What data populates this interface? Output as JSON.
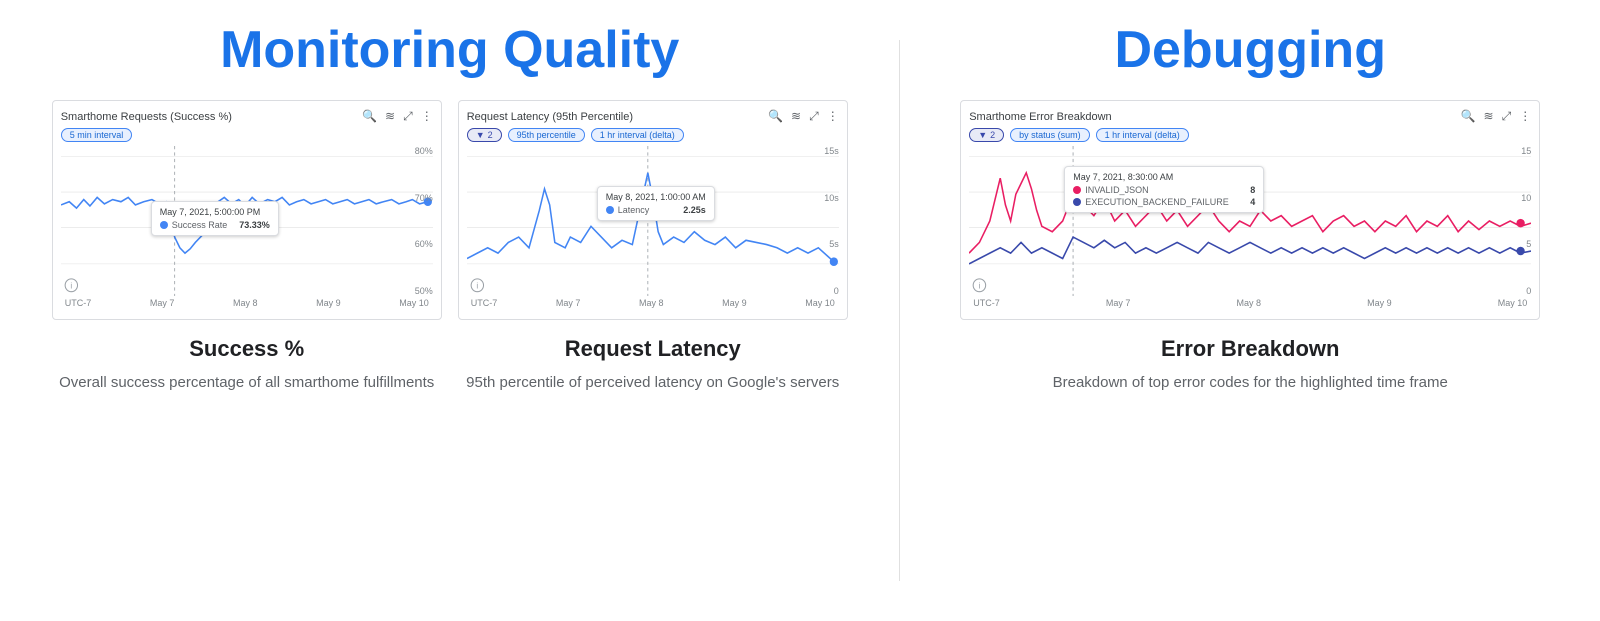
{
  "monitoring": {
    "title": "Monitoring Quality",
    "charts": [
      {
        "id": "success-rate",
        "title": "Smarthome Requests (Success %)",
        "filters": [
          "5 min interval"
        ],
        "filter_count": null,
        "y_labels": [
          "80%",
          "70%",
          "60%",
          "50%"
        ],
        "x_labels": [
          "UTC-7",
          "May 7",
          "May 8",
          "May 9",
          "May 10"
        ],
        "tooltip": {
          "date": "May 7, 2021, 5:00:00 PM",
          "metric": "Success Rate",
          "value": "73.33%",
          "color": "#4285f4"
        },
        "color": "#4285f4"
      },
      {
        "id": "request-latency",
        "title": "Request Latency (95th Percentile)",
        "filters": [
          "95th percentile",
          "1 hr interval (delta)"
        ],
        "filter_count": "2",
        "y_labels": [
          "15s",
          "10s",
          "5s",
          "0"
        ],
        "x_labels": [
          "UTC-7",
          "May 7",
          "May 8",
          "May 9",
          "May 10"
        ],
        "tooltip": {
          "date": "May 8, 2021, 1:00:00 AM",
          "metric": "Latency",
          "value": "2.25s",
          "color": "#4285f4"
        },
        "color": "#4285f4"
      }
    ],
    "metrics": [
      {
        "title": "Success %",
        "desc": "Overall success percentage of all smarthome fulfillments"
      },
      {
        "title": "Request Latency",
        "desc": "95th percentile of perceived latency on Google's servers"
      }
    ]
  },
  "debugging": {
    "title": "Debugging",
    "chart": {
      "id": "error-breakdown",
      "title": "Smarthome Error Breakdown",
      "filters": [
        "by status (sum)",
        "1 hr interval (delta)"
      ],
      "filter_count": "2",
      "y_labels": [
        "15",
        "10",
        "5",
        "0"
      ],
      "x_labels": [
        "UTC-7",
        "May 7",
        "May 8",
        "May 9",
        "May 10"
      ],
      "tooltip": {
        "date": "May 7, 2021, 8:30:00 AM",
        "rows": [
          {
            "label": "INVALID_JSON",
            "value": "8",
            "color": "#e91e63"
          },
          {
            "label": "EXECUTION_BACKEND_FAILURE",
            "value": "4",
            "color": "#3949ab"
          }
        ]
      },
      "colors": [
        "#e91e63",
        "#3949ab"
      ]
    },
    "metric": {
      "title": "Error Breakdown",
      "desc": "Breakdown of top error codes for the highlighted time frame"
    }
  }
}
